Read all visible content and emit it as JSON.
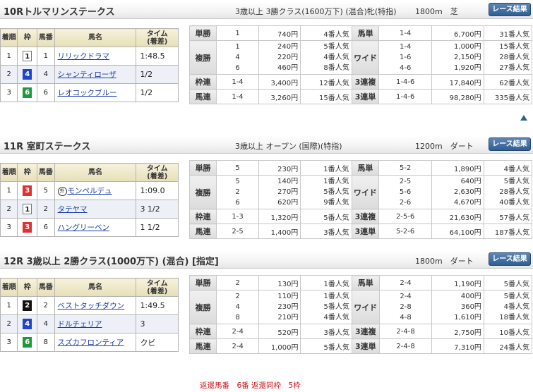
{
  "header_labels": {
    "rank": "着順",
    "waku": "枠",
    "umaban": "馬番",
    "name": "馬名",
    "time": "タイム",
    "margin": "(着差)"
  },
  "race_button_label": "レース結果",
  "races": [
    {
      "title": "10Rトルマリンステークス",
      "conditions": "3歳以上 3勝クラス(1600万下) (混合)牝(特指)",
      "distance": "1800m　芝",
      "results": [
        {
          "rank": "1",
          "waku": "1",
          "umaban": "1",
          "name": "リリックドラマ",
          "time": "1:48.5",
          "mark": ""
        },
        {
          "rank": "2",
          "waku": "4",
          "umaban": "4",
          "name": "シャンティローザ",
          "time": "1/2",
          "mark": ""
        },
        {
          "rank": "3",
          "waku": "6",
          "umaban": "6",
          "name": "レオコックブルー",
          "time": "1/2",
          "mark": ""
        }
      ],
      "payouts": {
        "win": {
          "label": "単勝",
          "nums": [
            "1"
          ],
          "amounts": [
            "740円"
          ],
          "pops": [
            "4番人気"
          ]
        },
        "place": {
          "label": "複勝",
          "nums": [
            "1",
            "4",
            "6"
          ],
          "amounts": [
            "240円",
            "220円",
            "460円"
          ],
          "pops": [
            "5番人気",
            "4番人気",
            "8番人気"
          ]
        },
        "bracket_q": {
          "label": "枠連",
          "num": "1-4",
          "amount": "3,400円",
          "pop": "12番人気"
        },
        "quinella": {
          "label": "馬連",
          "num": "1-4",
          "amount": "3,260円",
          "pop": "15番人気"
        },
        "exacta": {
          "label": "馬単",
          "num": "1-4",
          "amount": "6,700円",
          "pop": "31番人気"
        },
        "wide": {
          "label": "ワイド",
          "nums": [
            "1-4",
            "1-6",
            "4-6"
          ],
          "amounts": [
            "1,000円",
            "2,150円",
            "1,920円"
          ],
          "pops": [
            "15番人気",
            "28番人気",
            "27番人気"
          ]
        },
        "trio": {
          "label": "3連複",
          "num": "1-4-6",
          "amount": "17,840円",
          "pop": "62番人気"
        },
        "trifecta": {
          "label": "3連単",
          "num": "1-4-6",
          "amount": "98,280円",
          "pop": "335番人気"
        }
      }
    },
    {
      "title": "11R 室町ステークス",
      "conditions": "3歳以上 オープン (国際)(特指)",
      "distance": "1200m　ダート",
      "results": [
        {
          "rank": "1",
          "waku": "3",
          "umaban": "5",
          "name": "モンペルデュ",
          "time": "1:09.0",
          "mark": "外"
        },
        {
          "rank": "2",
          "waku": "1",
          "umaban": "2",
          "name": "タテヤマ",
          "time": "3 1/2",
          "mark": ""
        },
        {
          "rank": "3",
          "waku": "3",
          "umaban": "6",
          "name": "ハングリーベン",
          "time": "1 1/2",
          "mark": ""
        }
      ],
      "payouts": {
        "win": {
          "label": "単勝",
          "nums": [
            "5"
          ],
          "amounts": [
            "230円"
          ],
          "pops": [
            "1番人気"
          ]
        },
        "place": {
          "label": "複勝",
          "nums": [
            "5",
            "2",
            "6"
          ],
          "amounts": [
            "140円",
            "270円",
            "620円"
          ],
          "pops": [
            "1番人気",
            "5番人気",
            "9番人気"
          ]
        },
        "bracket_q": {
          "label": "枠連",
          "num": "1-3",
          "amount": "1,320円",
          "pop": "5番人気"
        },
        "quinella": {
          "label": "馬連",
          "num": "2-5",
          "amount": "1,400円",
          "pop": "3番人気"
        },
        "exacta": {
          "label": "馬単",
          "num": "5-2",
          "amount": "1,890円",
          "pop": "4番人気"
        },
        "wide": {
          "label": "ワイド",
          "nums": [
            "2-5",
            "5-6",
            "2-6"
          ],
          "amounts": [
            "640円",
            "2,630円",
            "4,670円"
          ],
          "pops": [
            "5番人気",
            "28番人気",
            "40番人気"
          ]
        },
        "trio": {
          "label": "3連複",
          "num": "2-5-6",
          "amount": "21,630円",
          "pop": "57番人気"
        },
        "trifecta": {
          "label": "3連単",
          "num": "5-2-6",
          "amount": "64,100円",
          "pop": "187番人気"
        }
      }
    },
    {
      "title": "12R 3歳以上 2勝クラス(1000万下) (混合) [指定]",
      "conditions": "",
      "distance": "1800m　ダート",
      "results": [
        {
          "rank": "1",
          "waku": "2",
          "umaban": "2",
          "name": "ベストタッチダウン",
          "time": "1:49.5",
          "mark": ""
        },
        {
          "rank": "2",
          "waku": "4",
          "umaban": "4",
          "name": "ドルチェリア",
          "time": "3",
          "mark": ""
        },
        {
          "rank": "3",
          "waku": "6",
          "umaban": "8",
          "name": "スズカフロンティア",
          "time": "クビ",
          "mark": ""
        }
      ],
      "payouts": {
        "win": {
          "label": "単勝",
          "nums": [
            "2"
          ],
          "amounts": [
            "130円"
          ],
          "pops": [
            "1番人気"
          ]
        },
        "place": {
          "label": "複勝",
          "nums": [
            "2",
            "4",
            "8"
          ],
          "amounts": [
            "110円",
            "230円",
            "210円"
          ],
          "pops": [
            "1番人気",
            "5番人気",
            "4番人気"
          ]
        },
        "bracket_q": {
          "label": "枠連",
          "num": "2-4",
          "amount": "520円",
          "pop": "3番人気"
        },
        "quinella": {
          "label": "馬連",
          "num": "2-4",
          "amount": "1,000円",
          "pop": "5番人気"
        },
        "exacta": {
          "label": "馬単",
          "num": "2-4",
          "amount": "1,190円",
          "pop": "5番人気"
        },
        "wide": {
          "label": "ワイド",
          "nums": [
            "2-4",
            "2-8",
            "4-8"
          ],
          "amounts": [
            "400円",
            "360円",
            "1,610円"
          ],
          "pops": [
            "5番人気",
            "4番人気",
            "18番人気"
          ]
        },
        "trio": {
          "label": "3連複",
          "num": "2-4-8",
          "amount": "2,750円",
          "pop": "10番人気"
        },
        "trifecta": {
          "label": "3連単",
          "num": "2-4-8",
          "amount": "7,310円",
          "pop": "24番人気"
        }
      },
      "note": "返還馬番　6番 返還同枠　5枠"
    }
  ],
  "colors": {
    "waku_1": "#ffffff",
    "waku_2": "#111111",
    "waku_3": "#e23030",
    "waku_4": "#2244cc",
    "waku_6": "#1f9a3a",
    "button": "#2e5f93",
    "note": "#d0141c"
  },
  "icons": {
    "page_top": "up-triangle-icon",
    "mark": "circled-gai-icon"
  }
}
